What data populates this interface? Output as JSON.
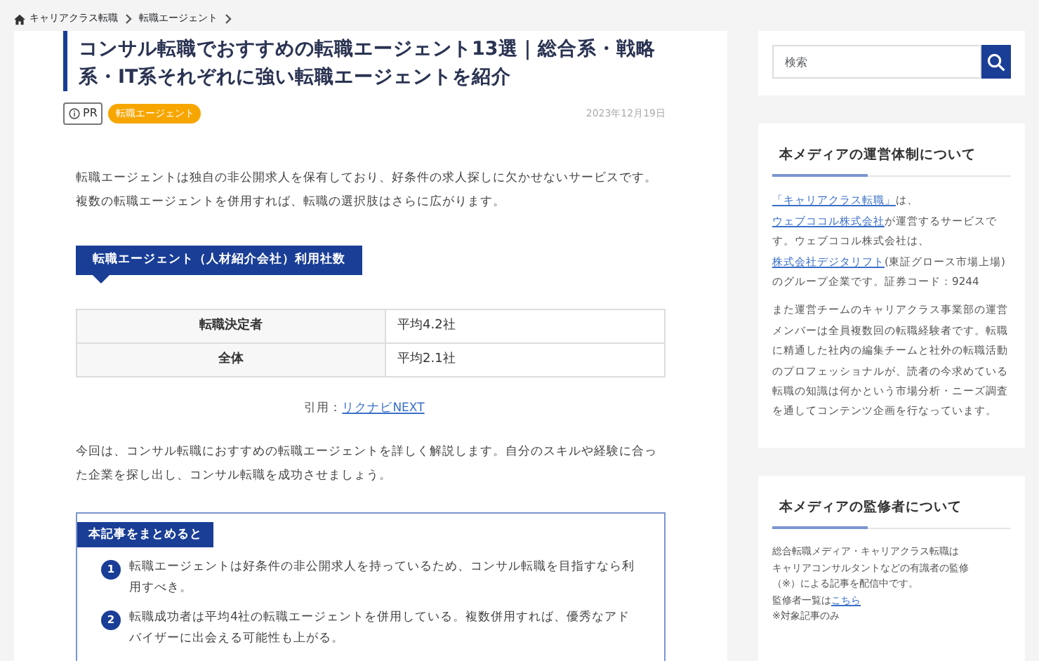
{
  "breadcrumb": [
    {
      "label": "キャリアクラス転職"
    },
    {
      "label": "転職エージェント"
    }
  ],
  "article": {
    "title": "コンサル転職でおすすめの転職エージェント13選｜総合系・戦略系・IT系それぞれに強い転職エージェントを紹介",
    "pr_label": "PR",
    "category": "転職エージェント",
    "date": "2023年12月19日",
    "intro": "転職エージェントは独自の非公開求人を保有しており、好条件の求人探しに欠かせないサービスです。複数の転職エージェントを併用すれば、転職の選択肢はさらに広がります。",
    "table_caption": "転職エージェント（人材紹介会社）利用社数",
    "table_rows": [
      {
        "label": "転職決定者",
        "value": "平均4.2社"
      },
      {
        "label": "全体",
        "value": "平均2.1社"
      }
    ],
    "citation_label": "引用：",
    "citation_link": "リクナビNEXT",
    "lead": "今回は、コンサル転職におすすめの転職エージェントを詳しく解説します。自分のスキルや経験に合った企業を探し出し、コンサル転職を成功させましょう。",
    "summary_title": "本記事をまとめると",
    "summary_items": [
      {
        "number": "1",
        "text": "転職エージェントは好条件の非公開求人を持っているため、コンサル転職を目指すなら利用すべき。"
      },
      {
        "number": "2",
        "text": "転職成功者は平均4社の転職エージェントを併用している。複数併用すれば、優秀なアドバイザーに出会える可能性も上がる。"
      }
    ]
  },
  "sidebar": {
    "search": {
      "placeholder": "検索"
    },
    "widgets": [
      {
        "title": "本メディアの運営体制について",
        "paragraphs": [
          [
            {
              "text": "「キャリアクラス転職」",
              "link": true
            },
            {
              "text": "は、",
              "link": false
            },
            {
              "text": "ウェブココル株式会社",
              "link": true
            },
            {
              "text": "が運営するサービスです。ウェブココル株式会社は、",
              "link": false
            },
            {
              "text": "株式会社デジタリフト",
              "link": true
            },
            {
              "text": "(東証グロース市場上場)のグループ企業です。証券コード：9244",
              "link": false
            }
          ],
          [
            {
              "text": "また運営チームのキャリアクラス事業部の運営メンバーは全員複数回の転職経験者です。転職に精通した社内の編集チームと社外の転職活動のプロフェッショナルが、読者の今求めている転職の知識は何かという市場分析・ニーズ調査を通してコンテンツ企画を行なっています。",
              "link": false
            }
          ]
        ]
      },
      {
        "title": "本メディアの監修者について",
        "lines": [
          [
            {
              "text": "総合転職メディア・キャリアクラス転職は",
              "link": false
            }
          ],
          [
            {
              "text": "キャリアコンサルタントなどの有識者の監修",
              "link": false
            }
          ],
          [
            {
              "text": "（※）による記事を配信中です。",
              "link": false
            }
          ],
          [
            {
              "text": "監修者一覧は",
              "link": false
            },
            {
              "text": "こちら",
              "link": true
            }
          ],
          [
            {
              "text": "※対象記事のみ",
              "link": false
            }
          ]
        ]
      }
    ]
  }
}
